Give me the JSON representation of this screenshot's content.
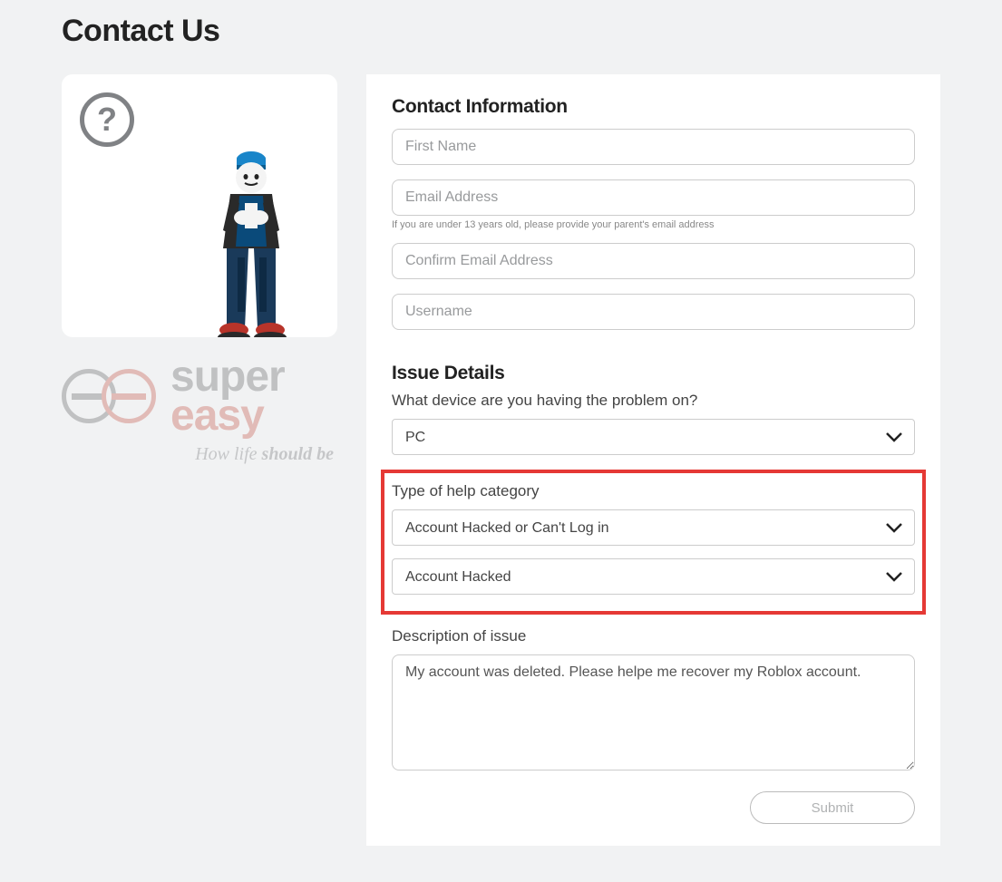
{
  "page": {
    "title": "Contact Us"
  },
  "watermark": {
    "line1": "super",
    "line2": "easy",
    "tagline_plain": "How life ",
    "tagline_bold": "should be"
  },
  "contact": {
    "section_title": "Contact Information",
    "first_name_placeholder": "First Name",
    "first_name_value": "",
    "email_placeholder": "Email Address",
    "email_value": "",
    "email_hint": "If you are under 13 years old, please provide your parent's email address",
    "confirm_email_placeholder": "Confirm Email Address",
    "confirm_email_value": "",
    "username_placeholder": "Username",
    "username_value": ""
  },
  "issue": {
    "section_title": "Issue Details",
    "device_label": "What device are you having the problem on?",
    "device_value": "PC",
    "category_label": "Type of help category",
    "category_value": "Account Hacked or Can't Log in",
    "subcategory_value": "Account Hacked",
    "description_label": "Description of issue",
    "description_value": "My account was deleted. Please helpe me recover my Roblox account."
  },
  "actions": {
    "submit_label": "Submit"
  }
}
